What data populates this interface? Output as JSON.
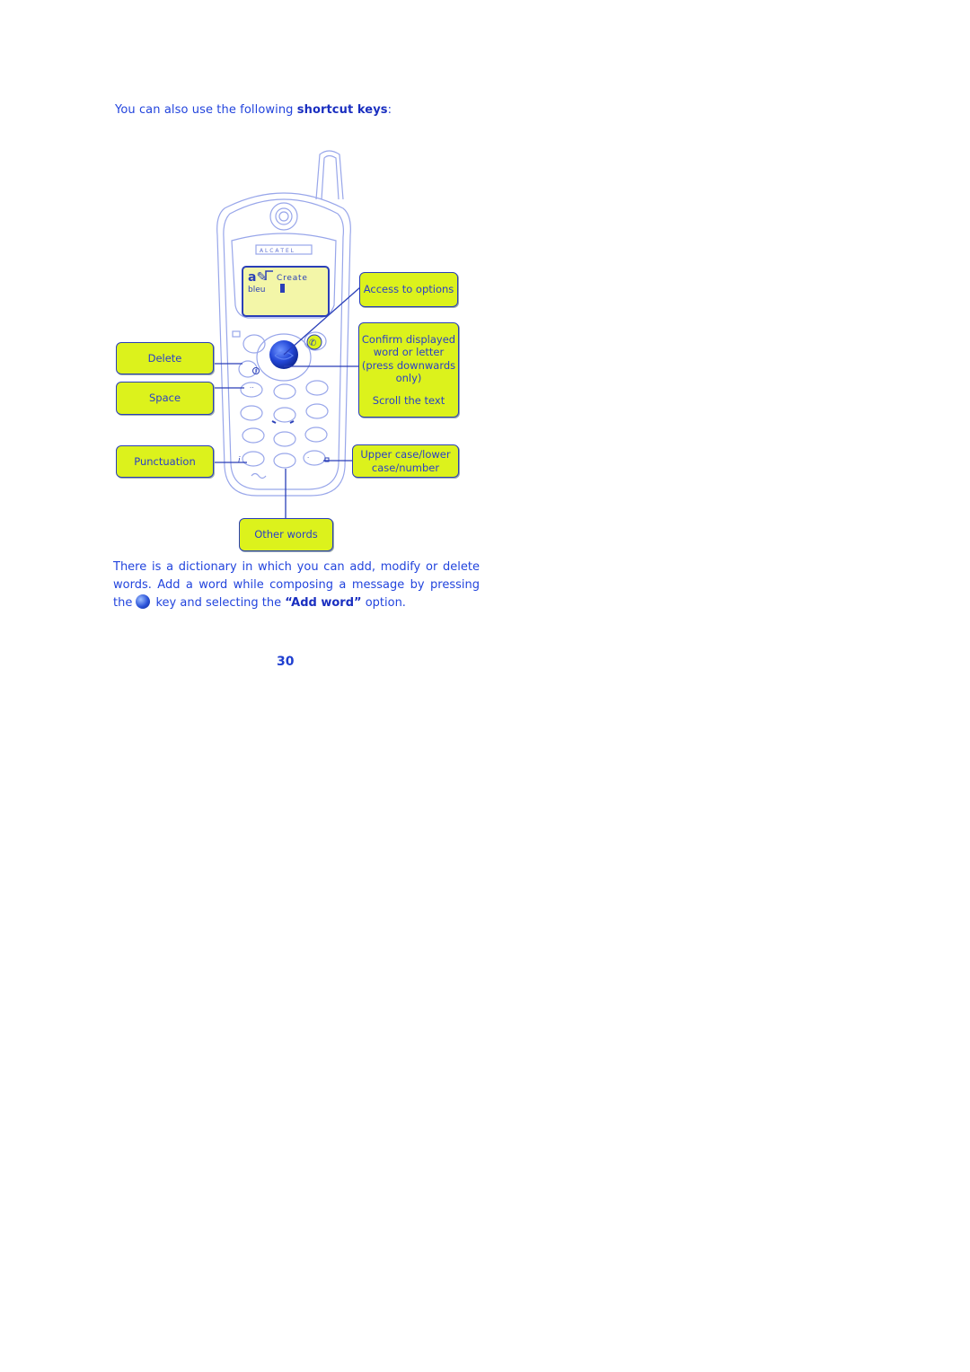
{
  "intro": {
    "text": "You can also use the following ",
    "bold": "shortcut keys",
    "suffix": ":"
  },
  "phone": {
    "brand": "A L C A T E L",
    "screen": {
      "title": "Create",
      "word": "bleu"
    }
  },
  "callouts": {
    "access_options": "Access to options",
    "confirm": [
      "Confirm displayed",
      "word or letter",
      "(press downwards",
      "only)"
    ],
    "scroll": "Scroll the text",
    "delete": "Delete",
    "space": "Space",
    "punctuation": "Punctuation",
    "case": [
      "Upper case/lower",
      "case/number"
    ],
    "other_words": "Other words"
  },
  "paragraph": {
    "line1": "There is a dictionary in which you can add, modify or delete words. Add a word while composing a message by pressing the ",
    "line2_pre": "key and selecting the ",
    "bold": "“Add word”",
    "line2_post": " option."
  },
  "page_number": "30",
  "colors": {
    "callout_fill": "#dcf21c",
    "text_blue": "#2244dd",
    "outline": "#8fa0e8"
  }
}
